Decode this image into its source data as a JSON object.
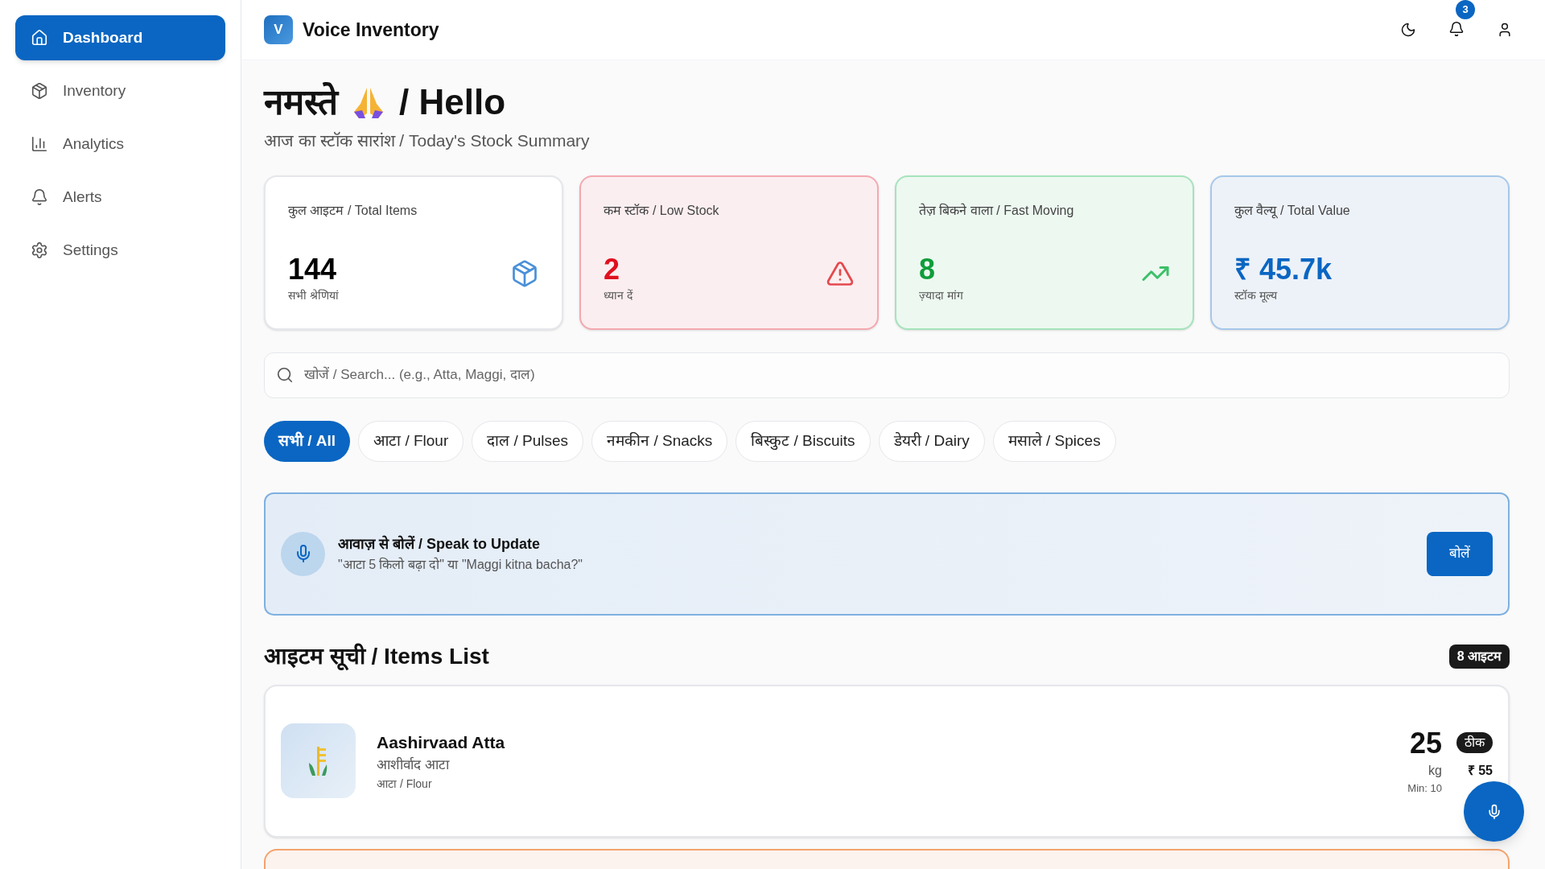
{
  "sidebar": {
    "items": [
      {
        "label": "Dashboard",
        "selected": true
      },
      {
        "label": "Inventory",
        "selected": false
      },
      {
        "label": "Analytics",
        "selected": false
      },
      {
        "label": "Alerts",
        "selected": false
      },
      {
        "label": "Settings",
        "selected": false
      }
    ]
  },
  "header": {
    "logo_letter": "V",
    "title": "Voice Inventory",
    "notification_count": "3"
  },
  "greeting": {
    "title_hindi": "नमस्ते",
    "title_english": "/ Hello",
    "subtitle": "आज का स्टॉक सारांश / Today's Stock Summary"
  },
  "stats": [
    {
      "label": "कुल आइटम / Total Items",
      "value": "144",
      "note": "सभी श्रेणियां",
      "kind": "neutral"
    },
    {
      "label": "कम स्टॉक / Low Stock",
      "value": "2",
      "note": "ध्यान दें",
      "kind": "danger"
    },
    {
      "label": "तेज़ बिकने वाला / Fast Moving",
      "value": "8",
      "note": "ज़्यादा मांग",
      "kind": "success"
    },
    {
      "label": "कुल वैल्यू / Total Value",
      "value": "₹ 45.7k",
      "note": "स्टॉक मूल्य",
      "kind": "info"
    }
  ],
  "search": {
    "placeholder": "खोजें / Search... (e.g., Atta, Maggi, दाल)"
  },
  "categories": [
    {
      "label": "सभी / All",
      "selected": true
    },
    {
      "label": "आटा / Flour",
      "selected": false
    },
    {
      "label": "दाल / Pulses",
      "selected": false
    },
    {
      "label": "नमकीन / Snacks",
      "selected": false
    },
    {
      "label": "बिस्कुट / Biscuits",
      "selected": false
    },
    {
      "label": "डेयरी / Dairy",
      "selected": false
    },
    {
      "label": "मसाले / Spices",
      "selected": false
    }
  ],
  "voice": {
    "title": "आवाज़ से बोलें / Speak to Update",
    "example": "\"आटा 5 किलो बढ़ा दो\" या \"Maggi kitna bacha?\"",
    "button": "बोलें"
  },
  "items_list": {
    "title": "आइटम सूची / Items List",
    "count": "8 आइटम",
    "items": [
      {
        "name": "Aashirvaad Atta",
        "hindi_name": "आशीर्वाद आटा",
        "category": "आटा / Flour",
        "quantity": "25",
        "unit": "kg",
        "min": "Min: 10",
        "status": "ठीक",
        "price": "₹ 55",
        "kind": "ok"
      },
      {
        "kind": "low"
      }
    ]
  }
}
